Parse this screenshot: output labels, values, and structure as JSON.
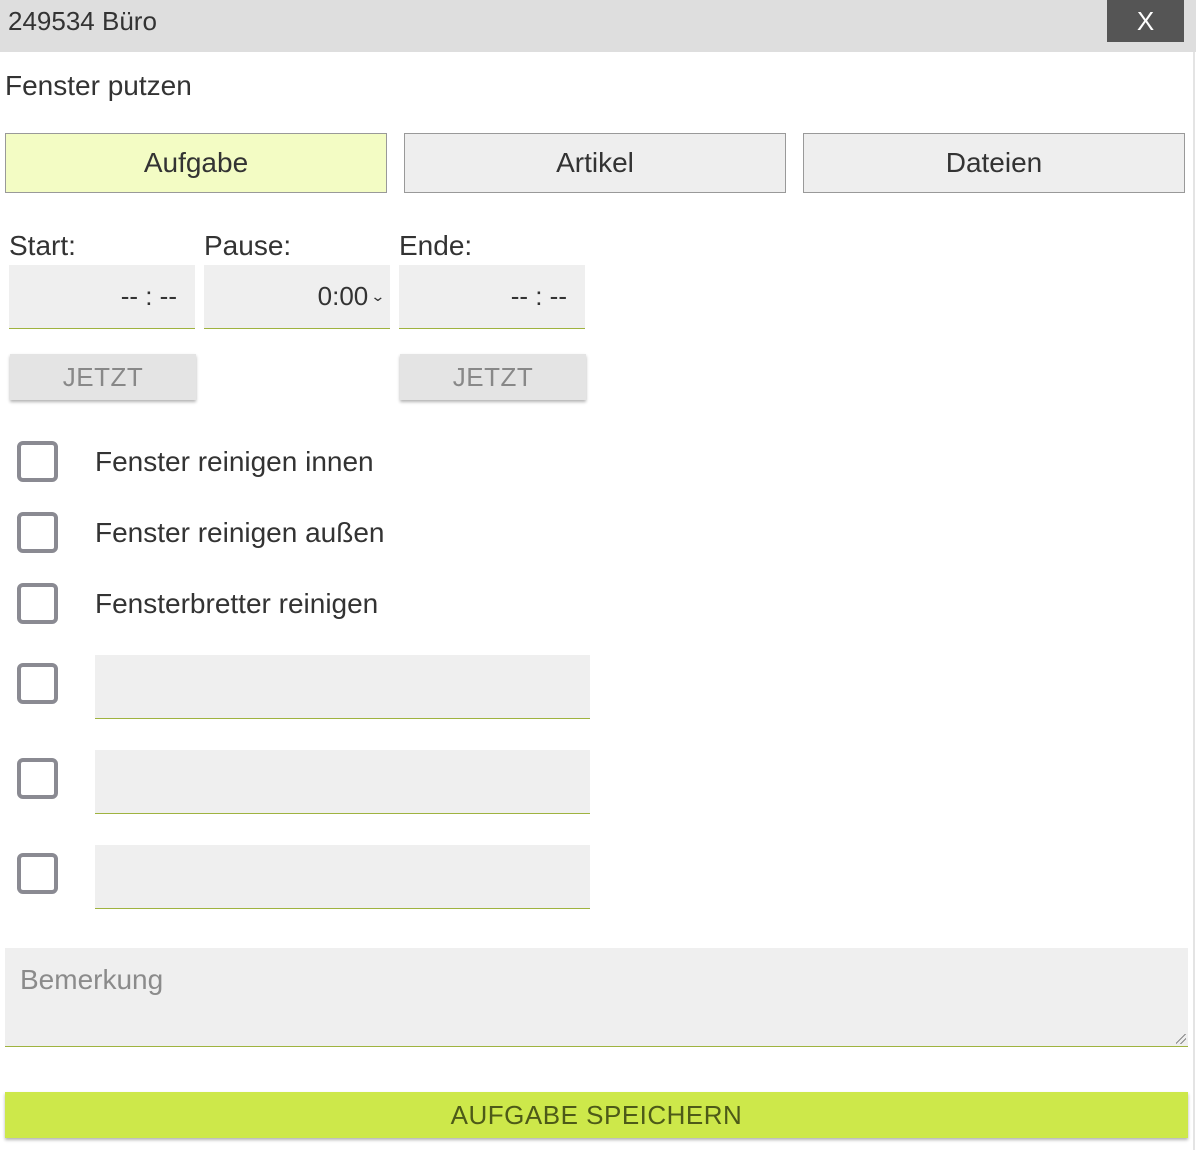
{
  "window": {
    "title": "249534 Büro",
    "close_label": "X"
  },
  "task": {
    "name": "Fenster putzen"
  },
  "tabs": [
    {
      "label": "Aufgabe",
      "active": true
    },
    {
      "label": "Artikel",
      "active": false
    },
    {
      "label": "Dateien",
      "active": false
    }
  ],
  "time": {
    "start_label": "Start:",
    "start_value": "-- : --",
    "pause_label": "Pause:",
    "pause_value": "0:00",
    "end_label": "Ende:",
    "end_value": "-- : --",
    "now_label": "JETZT"
  },
  "checklist": [
    {
      "label": "Fenster reinigen innen",
      "checked": false
    },
    {
      "label": "Fenster reinigen außen",
      "checked": false
    },
    {
      "label": "Fensterbretter reinigen",
      "checked": false
    }
  ],
  "custom_items": [
    {
      "value": "",
      "checked": false
    },
    {
      "value": "",
      "checked": false
    },
    {
      "value": "",
      "checked": false
    }
  ],
  "remark": {
    "placeholder": "Bemerkung"
  },
  "save_label": "AUFGABE SPEICHERN",
  "colors": {
    "active_tab": "#f3fcc4",
    "save_button": "#cde84a",
    "field_underline": "#9fb33f"
  }
}
